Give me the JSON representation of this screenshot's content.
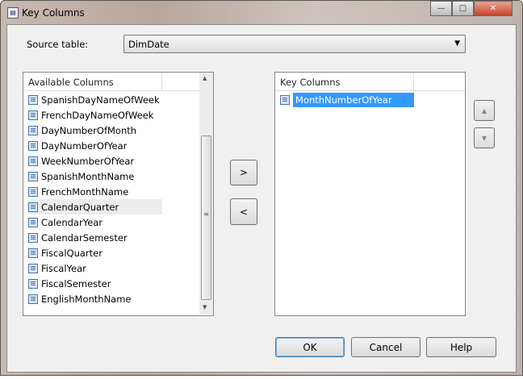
{
  "window": {
    "title": "Key Columns"
  },
  "source": {
    "label": "Source table:",
    "value": "DimDate"
  },
  "available": {
    "header": "Available Columns",
    "items": [
      "SpanishDayNameOfWeek",
      "FrenchDayNameOfWeek",
      "DayNumberOfMonth",
      "DayNumberOfYear",
      "WeekNumberOfYear",
      "SpanishMonthName",
      "FrenchMonthName",
      "CalendarQuarter",
      "CalendarYear",
      "CalendarSemester",
      "FiscalQuarter",
      "FiscalYear",
      "FiscalSemester",
      "EnglishMonthName"
    ],
    "hovered": "CalendarQuarter"
  },
  "key": {
    "header": "Key Columns",
    "items": [
      "MonthNumberOfYear"
    ]
  },
  "buttons": {
    "add": ">",
    "remove": "<",
    "ok": "OK",
    "cancel": "Cancel",
    "help": "Help",
    "up": "▲",
    "down": "▼"
  },
  "colors": {
    "selection": "#3399ff",
    "dialog": "#f0f0f0"
  }
}
